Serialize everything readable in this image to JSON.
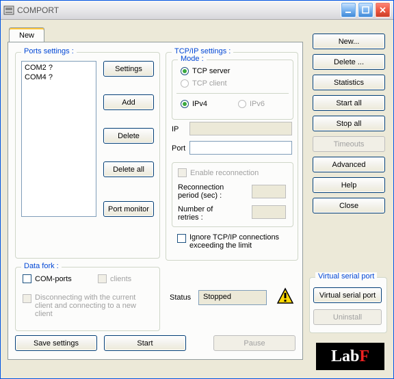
{
  "window": {
    "title": "COMPORT"
  },
  "tabs": [
    {
      "label": "New"
    }
  ],
  "ports_group": {
    "title": "Ports settings :",
    "items": [
      "COM2 ?",
      "COM4 ?"
    ],
    "buttons": {
      "settings": "Settings",
      "add": "Add",
      "delete": "Delete",
      "delete_all": "Delete all",
      "port_monitor": "Port monitor"
    }
  },
  "tcpip_group": {
    "title": "TCP/IP settings :",
    "mode": {
      "title": "Mode :",
      "tcp_server": "TCP server",
      "tcp_client": "TCP client",
      "ipv4": "IPv4",
      "ipv6": "IPv6"
    },
    "ip_label": "IP",
    "port_label": "Port",
    "enable_reconnection": "Enable reconnection",
    "reconnection_period": "Reconnection period (sec) :",
    "number_of_retries": "Number of retries :",
    "ignore_limit": "Ignore TCP/IP connections exceeding the limit"
  },
  "datafork_group": {
    "title": "Data fork :",
    "com_ports": "COM-ports",
    "clients": "clients",
    "disconnect_text": "Disconnecting with the current client and connecting to a new client"
  },
  "status": {
    "label": "Status",
    "value": "Stopped"
  },
  "bottom_buttons": {
    "save": "Save settings",
    "start": "Start",
    "pause": "Pause"
  },
  "side_buttons": {
    "new": "New...",
    "delete": "Delete ...",
    "statistics": "Statistics",
    "start_all": "Start all",
    "stop_all": "Stop all",
    "timeouts": "Timeouts",
    "advanced": "Advanced",
    "help": "Help",
    "close": "Close"
  },
  "vsp_group": {
    "title": "Virtual serial port",
    "virtual": "Virtual serial port",
    "uninstall": "Uninstall"
  },
  "logo": {
    "text1": "Lab",
    "text2": "F"
  }
}
